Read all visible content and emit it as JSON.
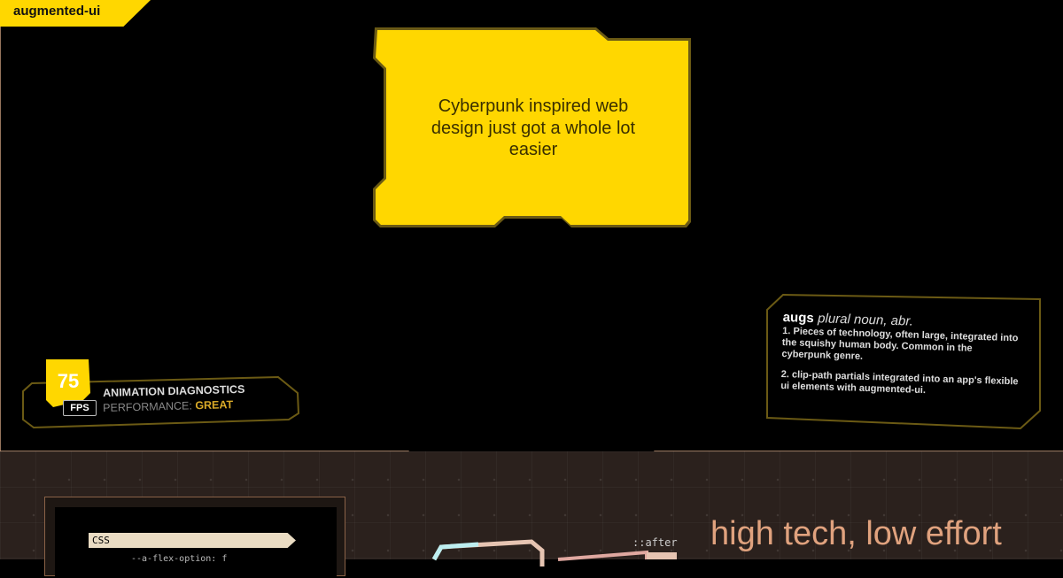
{
  "brand": {
    "logo_text": "augmented-ui"
  },
  "hero": {
    "card_text": "Cyberpunk inspired web design just got a whole lot easier"
  },
  "diagnostics": {
    "fps_value": "75",
    "fps_label": "FPS",
    "title": "ANIMATION DIAGNOSTICS",
    "performance_label": "PERFORMANCE:",
    "performance_value": "GREAT"
  },
  "definition": {
    "word": "augs",
    "part_of_speech": "plural noun, abr.",
    "sense_1": "1. Pieces of technology, often large, integrated into the squishy human body. Common in the cyberpunk genre.",
    "sense_2": "2. clip-path partials integrated into an app's flexible ui elements with augmented-ui."
  },
  "lower": {
    "code_tag": "CSS",
    "code_peek": "--a-flex-option: f",
    "after_label": "::after",
    "tagline": "high tech, low effort"
  },
  "colors": {
    "accent": "#ffd700",
    "frame_border": "#c89b7b",
    "tagline": "#e0a27e",
    "panel_border": "#6b5a14"
  }
}
